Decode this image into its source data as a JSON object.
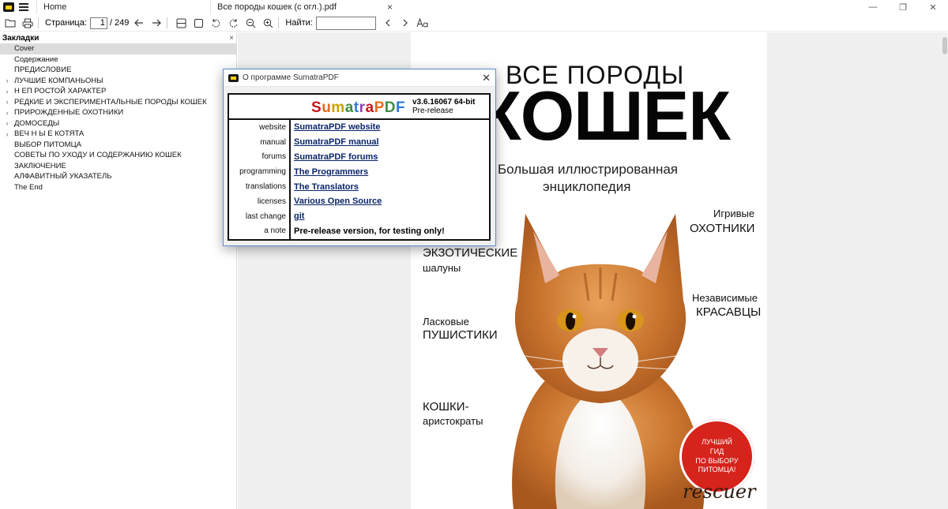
{
  "window": {
    "tabs": [
      {
        "label": "Home"
      },
      {
        "label": "Все породы кошек (с огл.).pdf"
      }
    ],
    "tab_close": "×",
    "controls": {
      "minimize": "—",
      "restore": "❐",
      "close": "✕"
    }
  },
  "toolbar": {
    "page_label": "Страница:",
    "page_value": "1",
    "page_total": "/ 249",
    "find_label": "Найти:",
    "find_value": "",
    "icons": [
      "open-folder-icon",
      "print-icon",
      "back-arrow-icon",
      "forward-arrow-icon",
      "single-page-icon",
      "fit-page-icon",
      "rotate-left-icon",
      "rotate-right-icon",
      "zoom-out-icon",
      "zoom-in-icon",
      "find-prev-icon",
      "find-next-icon",
      "match-case-icon"
    ]
  },
  "sidebar": {
    "title": "Закладки",
    "close": "×",
    "items": [
      {
        "label": "Cover",
        "expandable": false,
        "selected": true
      },
      {
        "label": "Содержание",
        "expandable": false
      },
      {
        "label": "ПРЕДИСЛОВИЕ",
        "expandable": false
      },
      {
        "label": "ЛУЧШИЕ КОМПАНЬОНЫ",
        "expandable": true
      },
      {
        "label": "Н ЕП РОСТОЙ ХАРАКТЕР",
        "expandable": true
      },
      {
        "label": "РЕДКИЕ И ЭКСПЕРИМЕНТАЛЬНЫЕ ПОРОДЫ КОШЕК",
        "expandable": true
      },
      {
        "label": "ПРИРОЖДЕННЫЕ ОХОТНИКИ",
        "expandable": true
      },
      {
        "label": "ДОМОСЕДЫ",
        "expandable": true
      },
      {
        "label": "ВЕЧ Н Ы Е КОТЯТА",
        "expandable": true
      },
      {
        "label": "ВЫБОР ПИТОМЦА",
        "expandable": false
      },
      {
        "label": "СОВЕТЫ ПО УХОДУ И СОДЕРЖАНИЮ КОШЕК",
        "expandable": false
      },
      {
        "label": "ЗАКЛЮЧЕНИЕ",
        "expandable": false
      },
      {
        "label": "АЛФАВИТНЫЙ УКАЗАТЕЛЬ",
        "expandable": false
      },
      {
        "label": "The End",
        "expandable": false
      }
    ]
  },
  "cover": {
    "title_top": "ВСЕ ПОРОДЫ",
    "title_big": "КОШЕК",
    "subtitle1": "Большая иллюстрированная",
    "subtitle2": "энциклопедия",
    "labels": {
      "playful_small": "Игривые",
      "playful_big": "ОХОТНИКИ",
      "exotic_big": "ЭКЗОТИЧЕСКИЕ",
      "exotic_small": "шалуны",
      "independent_small": "Независимые",
      "independent_big": "КРАСАВЦЫ",
      "affectionate_small": "Ласковые",
      "affectionate_big": "ПУШИСТИКИ",
      "aristo_big": "КОШКИ-",
      "aristo_small": "аристократы"
    },
    "badge": [
      "ЛУЧШИЙ",
      "ГИД",
      "ПО ВЫБОРУ",
      "ПИТОМЦА!"
    ],
    "publisher": "rescuer"
  },
  "dialog": {
    "title": "О программе SumatraPDF",
    "close": "✕",
    "logo_letters": [
      "S",
      "u",
      "m",
      "a",
      "t",
      "r",
      "a",
      "P",
      "D",
      "F"
    ],
    "logo_colors": [
      "#c4161c",
      "#e86a1e",
      "#c9a200",
      "#3e8e41",
      "#2f7ad1",
      "#8e44ad",
      "#c4161c",
      "#e86a1e",
      "#3e8e41",
      "#2f7ad1"
    ],
    "version": "v3.6.16067 64-bit",
    "version_sub": "Pre-release",
    "rows": [
      {
        "key": "website",
        "value": "SumatraPDF website",
        "link": true
      },
      {
        "key": "manual",
        "value": "SumatraPDF manual",
        "link": true
      },
      {
        "key": "forums",
        "value": "SumatraPDF forums",
        "link": true
      },
      {
        "key": "programming",
        "value": "The Programmers",
        "link": true
      },
      {
        "key": "translations",
        "value": "The Translators",
        "link": true
      },
      {
        "key": "licenses",
        "value": "Various Open Source",
        "link": true
      },
      {
        "key": "last change",
        "value": "git",
        "link": true
      },
      {
        "key": "a note",
        "value": "Pre-release version, for testing only!",
        "link": false
      }
    ]
  }
}
